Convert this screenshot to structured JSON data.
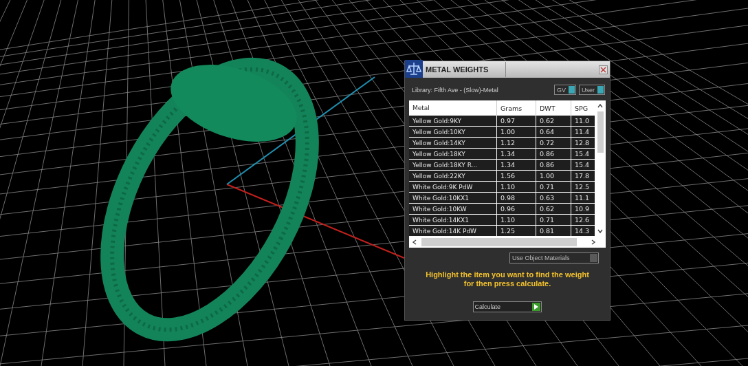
{
  "dialog": {
    "title": "METAL WEIGHTS",
    "library": "Library: Fifth Ave - (Slow)-Metal",
    "toggles": [
      {
        "label": "GV",
        "on": true
      },
      {
        "label": "User",
        "on": true
      }
    ],
    "table": {
      "columns": [
        "Metal",
        "Grams",
        "DWT",
        "SPG"
      ],
      "rows": [
        [
          "Yellow Gold:9KY",
          "0.97",
          "0.62",
          "11.0"
        ],
        [
          "Yellow Gold:10KY",
          "1.00",
          "0.64",
          "11.4"
        ],
        [
          "Yellow Gold:14KY",
          "1.12",
          "0.72",
          "12.8"
        ],
        [
          "Yellow Gold:18KY",
          "1.34",
          "0.86",
          "15.4"
        ],
        [
          "Yellow Gold:18KY R...",
          "1.34",
          "0.86",
          "15.4"
        ],
        [
          "Yellow Gold:22KY",
          "1.56",
          "1.00",
          "17.8"
        ],
        [
          "White Gold:9K PdW",
          "1.10",
          "0.71",
          "12.5"
        ],
        [
          "White Gold:10KX1",
          "0.98",
          "0.63",
          "11.1"
        ],
        [
          "White Gold:10KW",
          "0.96",
          "0.62",
          "10.9"
        ],
        [
          "White Gold:14KX1",
          "1.10",
          "0.71",
          "12.6"
        ],
        [
          "White Gold:14K PdW",
          "1.25",
          "0.81",
          "14.3"
        ]
      ]
    },
    "use_object_materials": {
      "label": "Use Object Materials",
      "on": false
    },
    "hint": "Highlight the item you want to find the weight for then press calculate.",
    "calculate_button": "Calculate"
  }
}
